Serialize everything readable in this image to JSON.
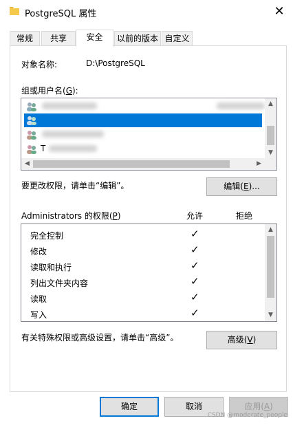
{
  "window": {
    "title": "PostgreSQL 属性",
    "close_glyph": "✕"
  },
  "tabs": [
    {
      "label": "常规",
      "active": false
    },
    {
      "label": "共享",
      "active": false
    },
    {
      "label": "安全",
      "active": true
    },
    {
      "label": "以前的版本",
      "active": false
    },
    {
      "label": "自定义",
      "active": false
    }
  ],
  "object": {
    "label": "对象名称:",
    "value": "D:\\PostgreSQL"
  },
  "users": {
    "label_prefix": "组或用户名(",
    "label_key": "G",
    "label_suffix": "):",
    "visible_fragment": "T",
    "icon": "user-group-icon"
  },
  "edit": {
    "hint": "要更改权限，请单击“编辑”。",
    "button_prefix": "编辑(",
    "button_key": "E",
    "button_suffix": ")..."
  },
  "permissions": {
    "label_prefix": "Administrators 的权限(",
    "label_key": "P",
    "label_suffix": ")",
    "allow_header": "允许",
    "deny_header": "拒绝",
    "check_glyph": "✓",
    "rows": [
      {
        "name": "完全控制",
        "allow": true
      },
      {
        "name": "修改",
        "allow": true
      },
      {
        "name": "读取和执行",
        "allow": true
      },
      {
        "name": "列出文件夹内容",
        "allow": true
      },
      {
        "name": "读取",
        "allow": true
      },
      {
        "name": "写入",
        "allow": true
      }
    ]
  },
  "advanced": {
    "hint": "有关特殊权限或高级设置，请单击“高级”。",
    "button_prefix": "高级(",
    "button_key": "V",
    "button_suffix": ")"
  },
  "footer": {
    "ok": "确定",
    "cancel": "取消",
    "apply_prefix": "应用(",
    "apply_key": "A",
    "apply_suffix": ")"
  },
  "watermark": "CSDN @moderate_people",
  "colors": {
    "accent": "#0078d7",
    "selection": "#0078d7"
  }
}
